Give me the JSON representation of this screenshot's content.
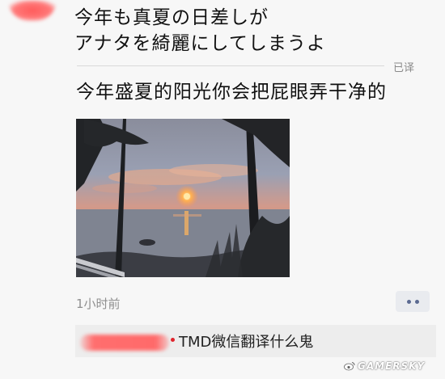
{
  "post": {
    "original_line_1": "今年も真夏の日差しが",
    "original_line_2": "アナタを綺麗にしてしまうよ",
    "translated_tag": "已译",
    "translation": "今年盛夏的阳光你会把屁眼弄干净的",
    "timestamp": "1小时前"
  },
  "comment": {
    "text": "TMD微信翻译什么鬼"
  },
  "watermark": {
    "text": "GAMERSKY"
  },
  "colors": {
    "background": "#f7f7f7",
    "redaction": "#ff6a6a",
    "comment_bg": "#ededed",
    "more_button_dots": "#5b6a91"
  },
  "icons": [
    "more-dots-icon",
    "weibo-logo-icon"
  ]
}
